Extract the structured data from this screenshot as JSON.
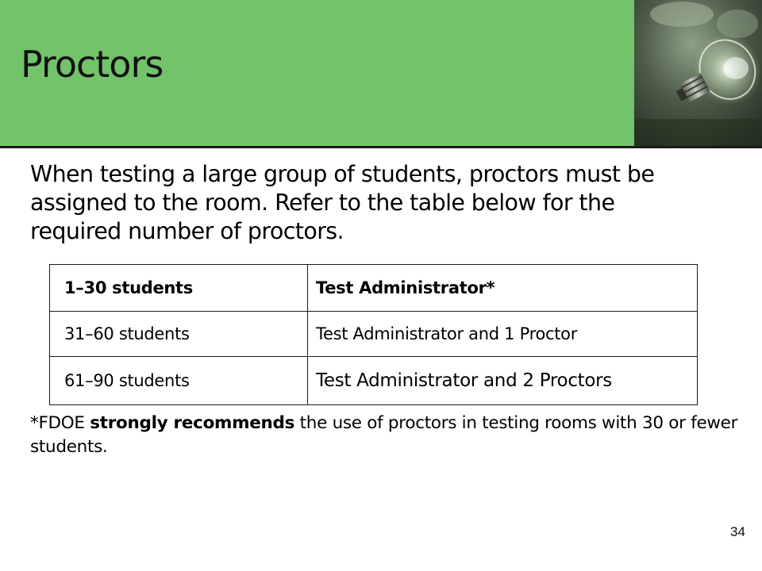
{
  "slide": {
    "title": "Proctors",
    "intro": "When testing a large group of students, proctors must be assigned to the room. Refer to the table below for the required number of proctors.",
    "table": {
      "rows": [
        {
          "students": "1–30 students",
          "staff": "Test Administrator*"
        },
        {
          "students": "31–60 students",
          "staff": "Test Administrator and 1 Proctor"
        },
        {
          "students": "61–90 students",
          "staff": "Test Administrator and 2 Proctors"
        }
      ]
    },
    "footnote": {
      "prefix": "*FDOE ",
      "emphasis": "strongly recommends",
      "suffix": " the use of proctors in testing rooms with 30 or fewer students."
    },
    "page_number": "34"
  },
  "colors": {
    "header_green": "#72c36a",
    "header_rule": "#1a1a1a",
    "text": "#000000"
  },
  "icons": {
    "header_image": "lightbulb-photo-icon"
  }
}
